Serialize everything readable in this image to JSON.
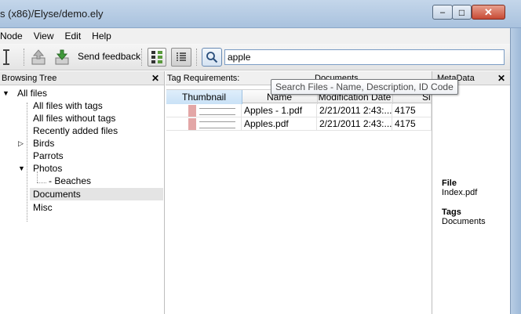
{
  "window": {
    "title": "s (x86)/Elyse/demo.ely",
    "minimize_glyph": "–",
    "maximize_glyph": "□",
    "close_glyph": "✕"
  },
  "menu": [
    "Node",
    "View",
    "Edit",
    "Help"
  ],
  "toolbar": {
    "send_feedback_label": "Send feedback",
    "search_value": "apple"
  },
  "tooltip": "Search Files - Name, Description, ID Code",
  "browsing_tree": {
    "title": "Browsing Tree",
    "close_glyph": "✕",
    "items": [
      {
        "label": "All files",
        "toggle": "▼"
      },
      {
        "label": "All files with tags",
        "toggle": ""
      },
      {
        "label": "All files without tags",
        "toggle": ""
      },
      {
        "label": "Recently added files",
        "toggle": ""
      },
      {
        "label": "Birds",
        "toggle": "▷"
      },
      {
        "label": "Parrots",
        "toggle": ""
      },
      {
        "label": "Photos",
        "toggle": "▼"
      },
      {
        "label": "- Beaches",
        "toggle": ""
      },
      {
        "label": "Documents",
        "toggle": ""
      },
      {
        "label": "Misc",
        "toggle": ""
      }
    ]
  },
  "files_panel": {
    "tag_requirements_label": "Tag Requirements:",
    "tag_requirements_value": "Documents",
    "columns": [
      "Thumbnail",
      "Name",
      "Modification Date",
      "Si"
    ],
    "rows": [
      {
        "name": "Apples - 1.pdf",
        "date": "2/21/2011 2:43:...",
        "size": "4175"
      },
      {
        "name": "Apples.pdf",
        "date": "2/21/2011 2:43:...",
        "size": "4175"
      }
    ]
  },
  "metadata": {
    "title": "MetaData",
    "close_glyph": "✕",
    "file_label": "File",
    "file_value": "Index.pdf",
    "tags_label": "Tags",
    "tags_value": "Documents"
  }
}
